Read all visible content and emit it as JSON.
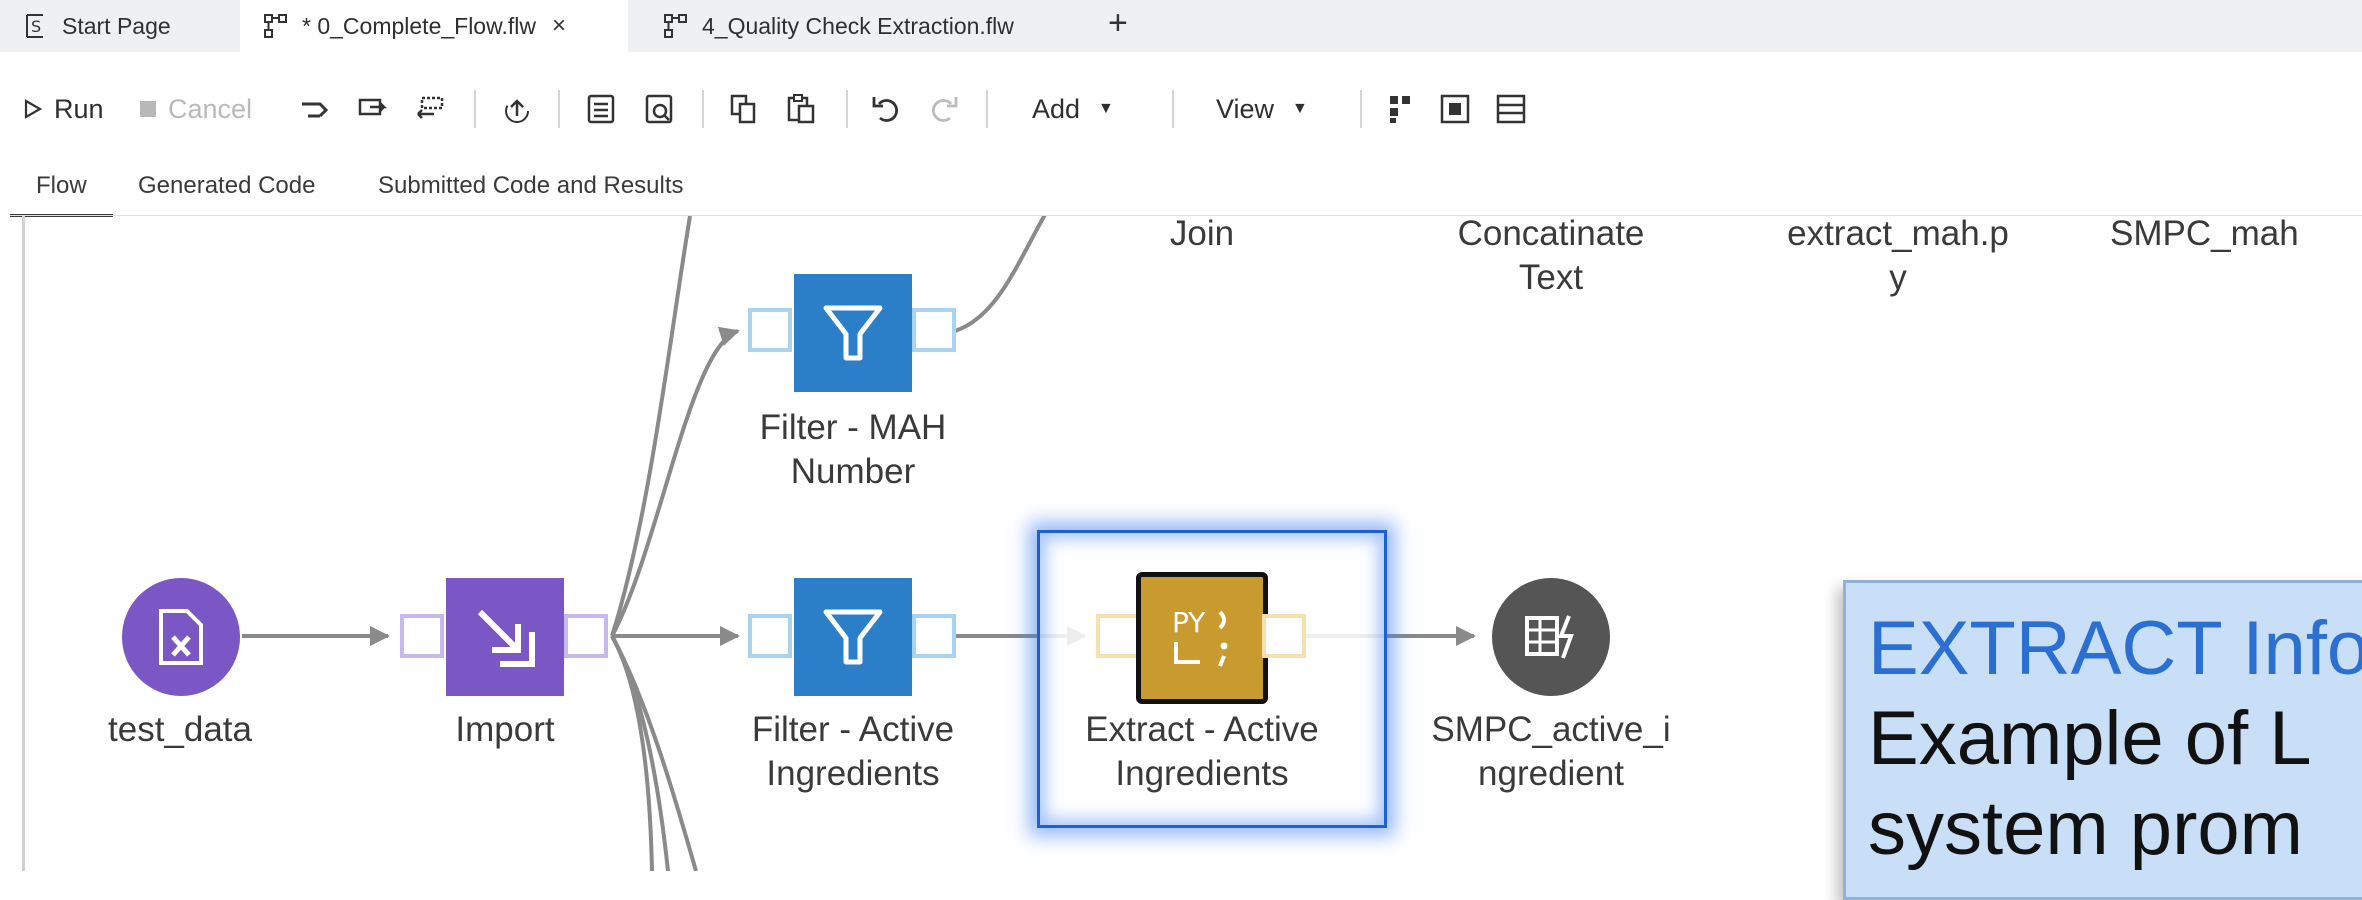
{
  "tabs": [
    {
      "label": "Start Page",
      "icon": "start-page-icon",
      "active": false
    },
    {
      "label": "* 0_Complete_Flow.flw",
      "icon": "flow-icon",
      "active": true,
      "close": "×"
    },
    {
      "label": "4_Quality Check Extraction.flw",
      "icon": "flow-icon",
      "active": false
    }
  ],
  "new_tab": "+",
  "toolbar": {
    "run_label": "Run",
    "run_icon": "play-icon",
    "cancel_label": "Cancel",
    "cancel_icon": "stop-icon",
    "add_label": "Add",
    "view_label": "View",
    "caret": "▼"
  },
  "view_tabs": [
    {
      "label": "Flow",
      "active": true
    },
    {
      "label": "Generated Code",
      "active": false
    },
    {
      "label": "Submitted Code and Results",
      "active": false
    }
  ],
  "nodes": {
    "test_data": {
      "label": "test_data",
      "color": "#7b57c6",
      "icon": "table-file-icon"
    },
    "import": {
      "label": "Import",
      "color": "#7b57c6",
      "icon": "import-icon"
    },
    "filter_mah": {
      "label_line1": "Filter - MAH",
      "label_line2": "Number",
      "color": "#2b7fc8",
      "icon": "filter-icon"
    },
    "filter_active": {
      "label_line1": "Filter - Active",
      "label_line2": "Ingredients",
      "color": "#2b7fc8",
      "icon": "filter-icon"
    },
    "extract_active": {
      "label_line1": "Extract - Active",
      "label_line2": "Ingredients",
      "color": "#c99a2e",
      "icon": "python-icon",
      "icon_text": "PY",
      "selected": true
    },
    "smpc_active": {
      "label_line1": "SMPC_active_i",
      "label_line2": "ngredient",
      "color": "#555555",
      "icon": "output-table-icon"
    },
    "join": {
      "label": "Join"
    },
    "concat": {
      "label_line1": "Concatinate",
      "label_line2": "Text"
    },
    "extract_mah": {
      "label_line1": "extract_mah.p",
      "label_line2": "y"
    },
    "smpc_mah": {
      "label": "SMPC_mah"
    }
  },
  "callout": {
    "line1": "EXTRACT Info",
    "line2": "Example of L",
    "line3": "system prom"
  },
  "colors": {
    "tabbar_bg": "#eef0f2",
    "selection_glow": "#3b7ef0",
    "port_purple": "#c8b8f0",
    "port_blue": "#a9d3f3",
    "port_yellow": "#f4e0b0",
    "wire": "#8a8a8a"
  }
}
